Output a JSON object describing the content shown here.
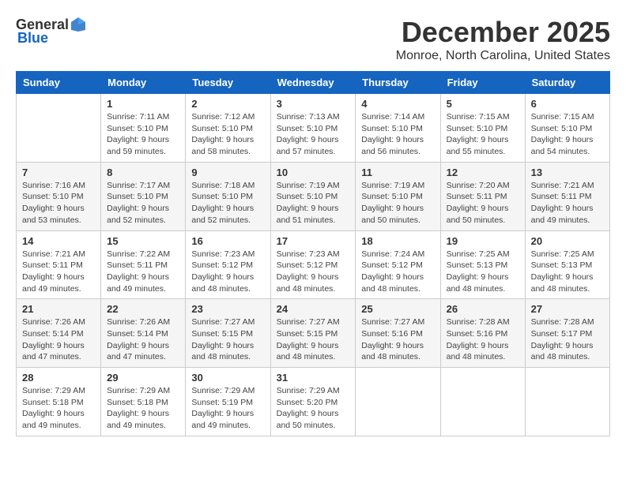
{
  "header": {
    "logo_general": "General",
    "logo_blue": "Blue",
    "month_title": "December 2025",
    "location": "Monroe, North Carolina, United States"
  },
  "days_of_week": [
    "Sunday",
    "Monday",
    "Tuesday",
    "Wednesday",
    "Thursday",
    "Friday",
    "Saturday"
  ],
  "weeks": [
    [
      {
        "day": "",
        "sunrise": "",
        "sunset": "",
        "daylight": ""
      },
      {
        "day": "1",
        "sunrise": "Sunrise: 7:11 AM",
        "sunset": "Sunset: 5:10 PM",
        "daylight": "Daylight: 9 hours and 59 minutes."
      },
      {
        "day": "2",
        "sunrise": "Sunrise: 7:12 AM",
        "sunset": "Sunset: 5:10 PM",
        "daylight": "Daylight: 9 hours and 58 minutes."
      },
      {
        "day": "3",
        "sunrise": "Sunrise: 7:13 AM",
        "sunset": "Sunset: 5:10 PM",
        "daylight": "Daylight: 9 hours and 57 minutes."
      },
      {
        "day": "4",
        "sunrise": "Sunrise: 7:14 AM",
        "sunset": "Sunset: 5:10 PM",
        "daylight": "Daylight: 9 hours and 56 minutes."
      },
      {
        "day": "5",
        "sunrise": "Sunrise: 7:15 AM",
        "sunset": "Sunset: 5:10 PM",
        "daylight": "Daylight: 9 hours and 55 minutes."
      },
      {
        "day": "6",
        "sunrise": "Sunrise: 7:15 AM",
        "sunset": "Sunset: 5:10 PM",
        "daylight": "Daylight: 9 hours and 54 minutes."
      }
    ],
    [
      {
        "day": "7",
        "sunrise": "Sunrise: 7:16 AM",
        "sunset": "Sunset: 5:10 PM",
        "daylight": "Daylight: 9 hours and 53 minutes."
      },
      {
        "day": "8",
        "sunrise": "Sunrise: 7:17 AM",
        "sunset": "Sunset: 5:10 PM",
        "daylight": "Daylight: 9 hours and 52 minutes."
      },
      {
        "day": "9",
        "sunrise": "Sunrise: 7:18 AM",
        "sunset": "Sunset: 5:10 PM",
        "daylight": "Daylight: 9 hours and 52 minutes."
      },
      {
        "day": "10",
        "sunrise": "Sunrise: 7:19 AM",
        "sunset": "Sunset: 5:10 PM",
        "daylight": "Daylight: 9 hours and 51 minutes."
      },
      {
        "day": "11",
        "sunrise": "Sunrise: 7:19 AM",
        "sunset": "Sunset: 5:10 PM",
        "daylight": "Daylight: 9 hours and 50 minutes."
      },
      {
        "day": "12",
        "sunrise": "Sunrise: 7:20 AM",
        "sunset": "Sunset: 5:11 PM",
        "daylight": "Daylight: 9 hours and 50 minutes."
      },
      {
        "day": "13",
        "sunrise": "Sunrise: 7:21 AM",
        "sunset": "Sunset: 5:11 PM",
        "daylight": "Daylight: 9 hours and 49 minutes."
      }
    ],
    [
      {
        "day": "14",
        "sunrise": "Sunrise: 7:21 AM",
        "sunset": "Sunset: 5:11 PM",
        "daylight": "Daylight: 9 hours and 49 minutes."
      },
      {
        "day": "15",
        "sunrise": "Sunrise: 7:22 AM",
        "sunset": "Sunset: 5:11 PM",
        "daylight": "Daylight: 9 hours and 49 minutes."
      },
      {
        "day": "16",
        "sunrise": "Sunrise: 7:23 AM",
        "sunset": "Sunset: 5:12 PM",
        "daylight": "Daylight: 9 hours and 48 minutes."
      },
      {
        "day": "17",
        "sunrise": "Sunrise: 7:23 AM",
        "sunset": "Sunset: 5:12 PM",
        "daylight": "Daylight: 9 hours and 48 minutes."
      },
      {
        "day": "18",
        "sunrise": "Sunrise: 7:24 AM",
        "sunset": "Sunset: 5:12 PM",
        "daylight": "Daylight: 9 hours and 48 minutes."
      },
      {
        "day": "19",
        "sunrise": "Sunrise: 7:25 AM",
        "sunset": "Sunset: 5:13 PM",
        "daylight": "Daylight: 9 hours and 48 minutes."
      },
      {
        "day": "20",
        "sunrise": "Sunrise: 7:25 AM",
        "sunset": "Sunset: 5:13 PM",
        "daylight": "Daylight: 9 hours and 48 minutes."
      }
    ],
    [
      {
        "day": "21",
        "sunrise": "Sunrise: 7:26 AM",
        "sunset": "Sunset: 5:14 PM",
        "daylight": "Daylight: 9 hours and 47 minutes."
      },
      {
        "day": "22",
        "sunrise": "Sunrise: 7:26 AM",
        "sunset": "Sunset: 5:14 PM",
        "daylight": "Daylight: 9 hours and 47 minutes."
      },
      {
        "day": "23",
        "sunrise": "Sunrise: 7:27 AM",
        "sunset": "Sunset: 5:15 PM",
        "daylight": "Daylight: 9 hours and 48 minutes."
      },
      {
        "day": "24",
        "sunrise": "Sunrise: 7:27 AM",
        "sunset": "Sunset: 5:15 PM",
        "daylight": "Daylight: 9 hours and 48 minutes."
      },
      {
        "day": "25",
        "sunrise": "Sunrise: 7:27 AM",
        "sunset": "Sunset: 5:16 PM",
        "daylight": "Daylight: 9 hours and 48 minutes."
      },
      {
        "day": "26",
        "sunrise": "Sunrise: 7:28 AM",
        "sunset": "Sunset: 5:16 PM",
        "daylight": "Daylight: 9 hours and 48 minutes."
      },
      {
        "day": "27",
        "sunrise": "Sunrise: 7:28 AM",
        "sunset": "Sunset: 5:17 PM",
        "daylight": "Daylight: 9 hours and 48 minutes."
      }
    ],
    [
      {
        "day": "28",
        "sunrise": "Sunrise: 7:29 AM",
        "sunset": "Sunset: 5:18 PM",
        "daylight": "Daylight: 9 hours and 49 minutes."
      },
      {
        "day": "29",
        "sunrise": "Sunrise: 7:29 AM",
        "sunset": "Sunset: 5:18 PM",
        "daylight": "Daylight: 9 hours and 49 minutes."
      },
      {
        "day": "30",
        "sunrise": "Sunrise: 7:29 AM",
        "sunset": "Sunset: 5:19 PM",
        "daylight": "Daylight: 9 hours and 49 minutes."
      },
      {
        "day": "31",
        "sunrise": "Sunrise: 7:29 AM",
        "sunset": "Sunset: 5:20 PM",
        "daylight": "Daylight: 9 hours and 50 minutes."
      },
      {
        "day": "",
        "sunrise": "",
        "sunset": "",
        "daylight": ""
      },
      {
        "day": "",
        "sunrise": "",
        "sunset": "",
        "daylight": ""
      },
      {
        "day": "",
        "sunrise": "",
        "sunset": "",
        "daylight": ""
      }
    ]
  ]
}
